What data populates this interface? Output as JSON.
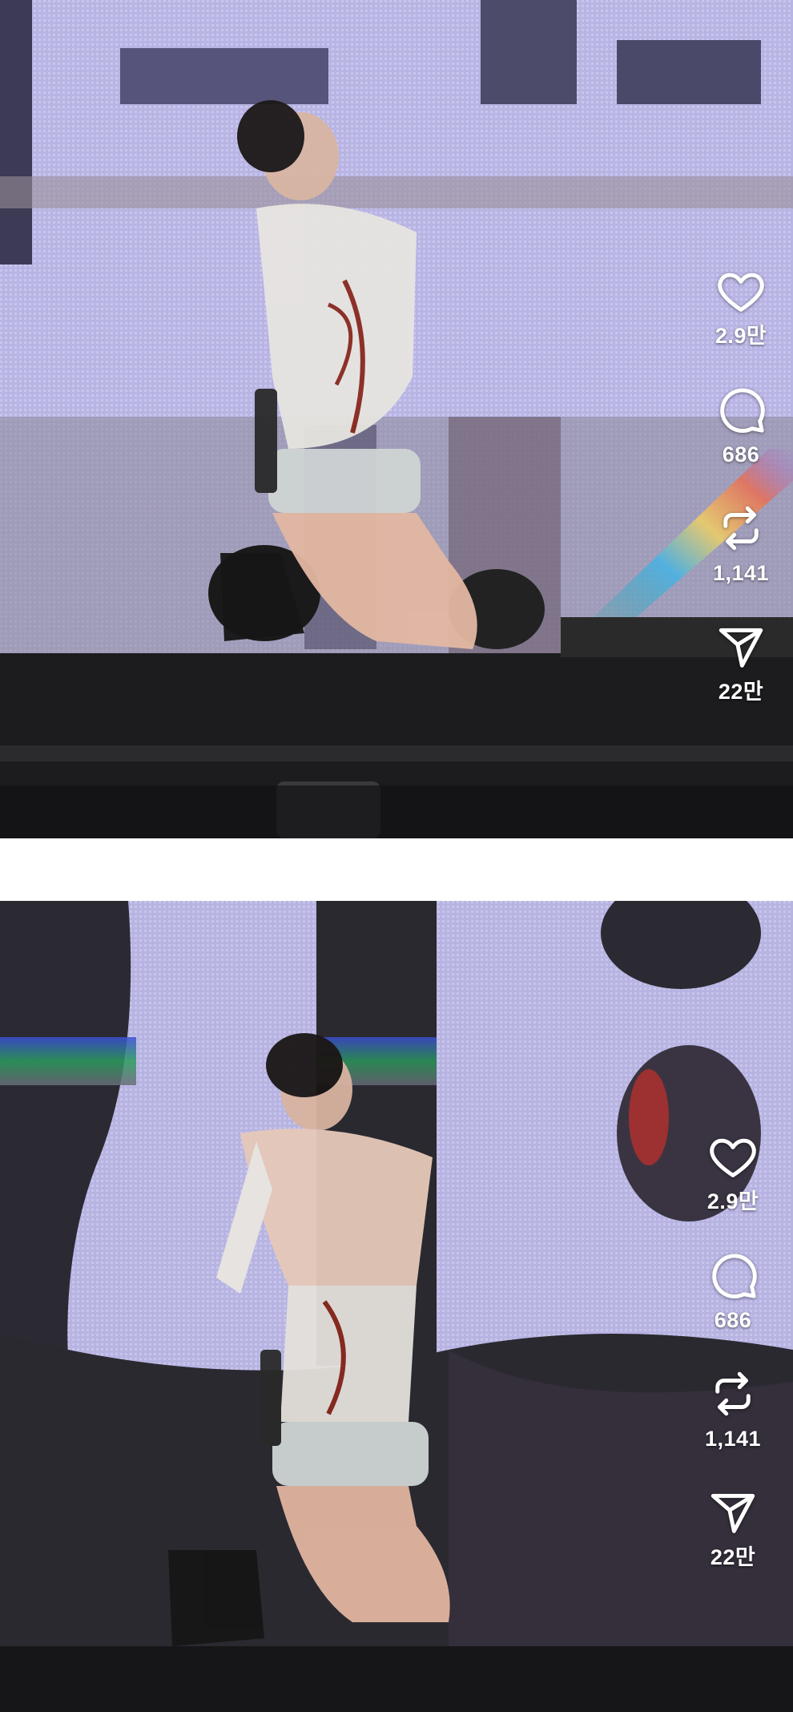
{
  "posts": [
    {
      "actions": {
        "like": {
          "icon": "heart-icon",
          "count": "2.9만"
        },
        "comment": {
          "icon": "comment-icon",
          "count": "686"
        },
        "repost": {
          "icon": "repost-icon",
          "count": "1,141"
        },
        "share": {
          "icon": "share-icon",
          "count": "22만"
        }
      }
    },
    {
      "actions": {
        "like": {
          "icon": "heart-icon",
          "count": "2.9만"
        },
        "comment": {
          "icon": "comment-icon",
          "count": "686"
        },
        "repost": {
          "icon": "repost-icon",
          "count": "1,141"
        },
        "share": {
          "icon": "share-icon",
          "count": "22만"
        }
      }
    }
  ],
  "colors": {
    "screen_lavender": "#b9b6e6",
    "screen_gray": "#8d8a9e",
    "stage_black": "#1c1c1e",
    "icon_white": "#ffffff"
  }
}
